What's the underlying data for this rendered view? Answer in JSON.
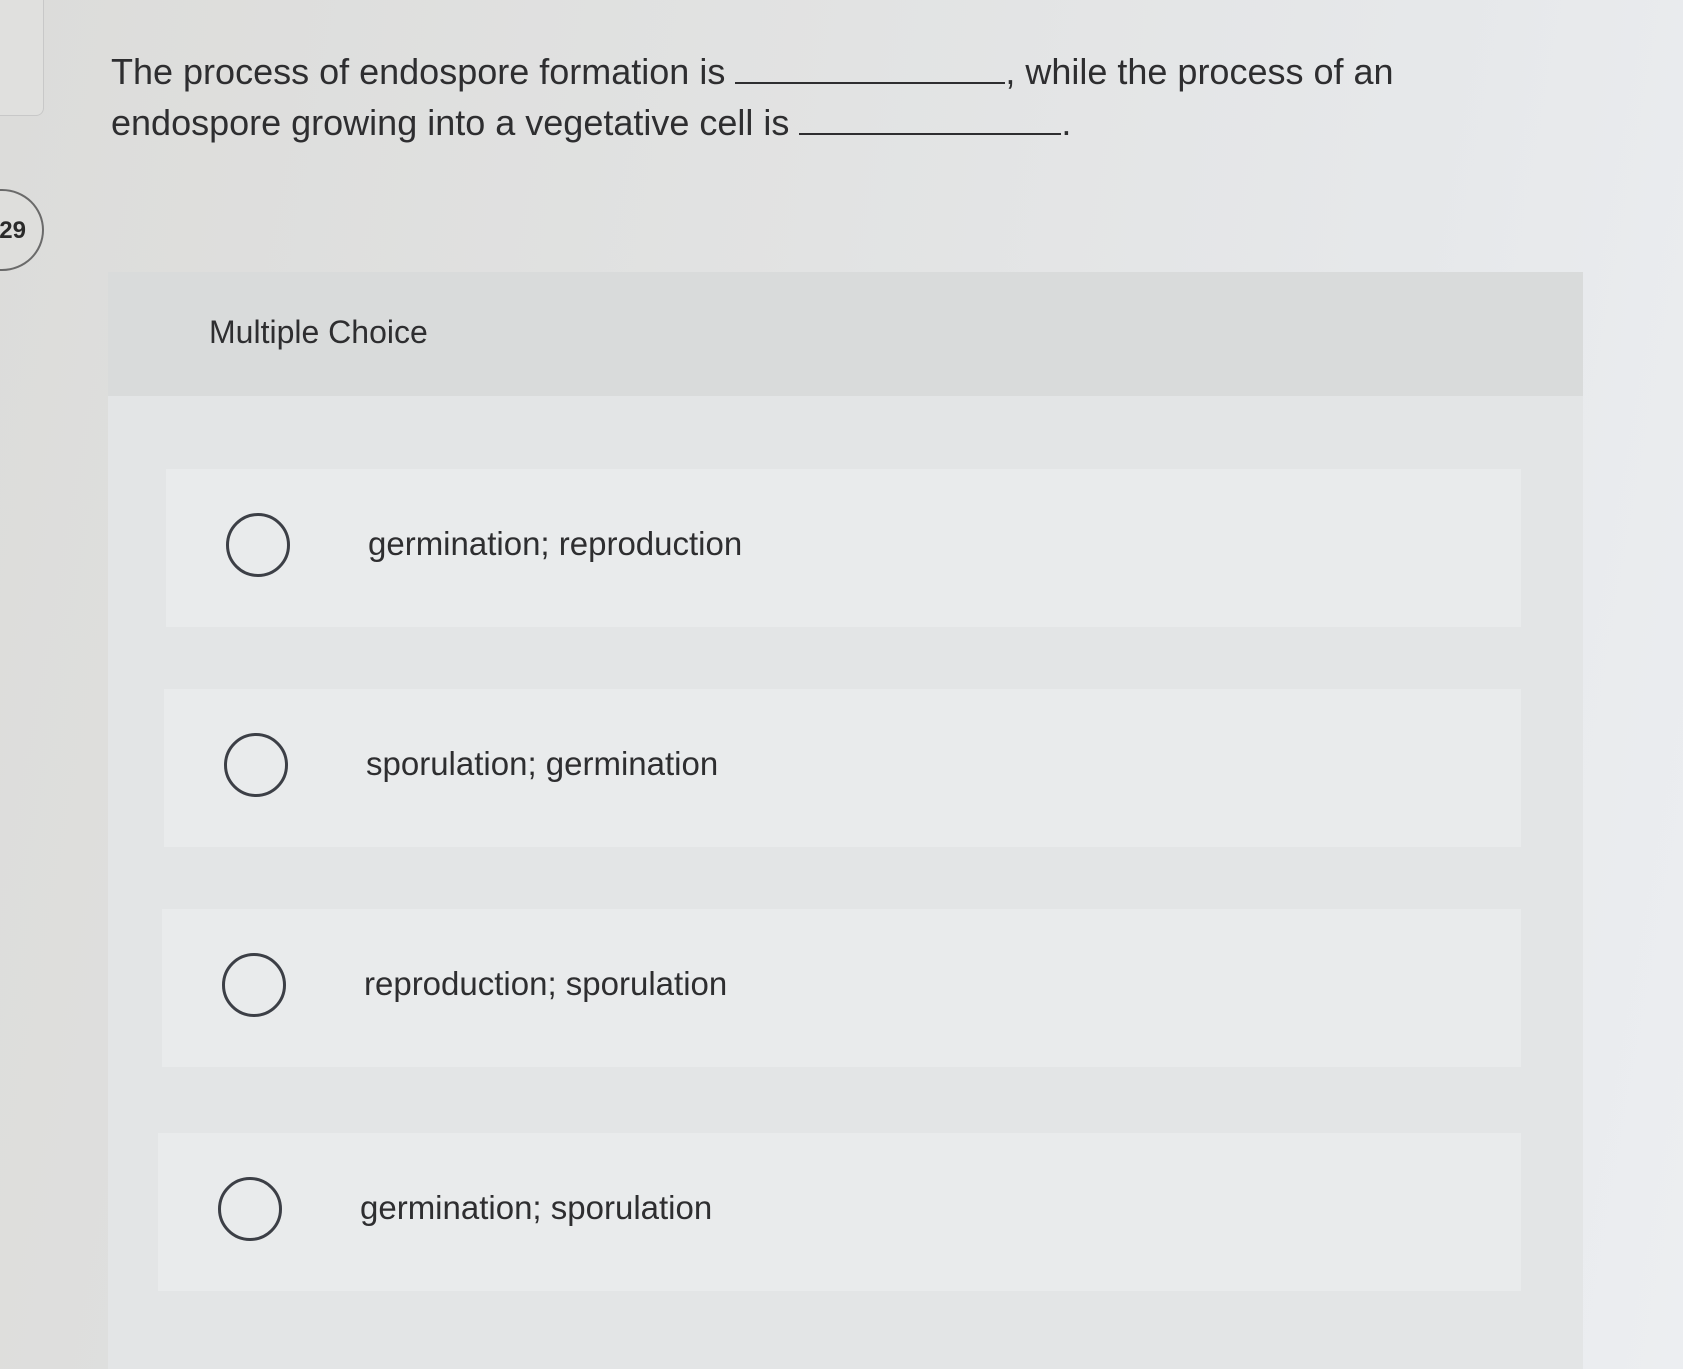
{
  "question": {
    "number": "29",
    "text_part1": "The process of endospore formation is ",
    "text_part2": ", while the process of an endospore growing into a vegetative cell is ",
    "text_part3": "."
  },
  "multiple_choice": {
    "heading": "Multiple Choice",
    "options": [
      {
        "label": "germination; reproduction",
        "selected": false
      },
      {
        "label": "sporulation; germination",
        "selected": false
      },
      {
        "label": "reproduction; sporulation",
        "selected": false
      },
      {
        "label": "germination; sporulation",
        "selected": false
      }
    ]
  }
}
